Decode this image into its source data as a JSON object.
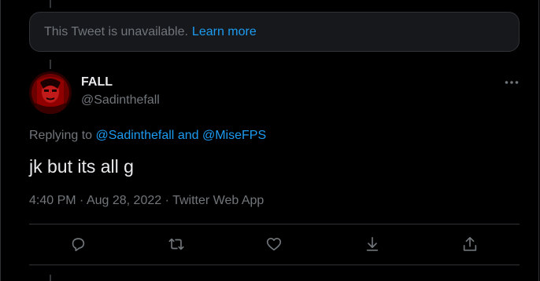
{
  "unavailable": {
    "message": "This Tweet is unavailable.",
    "learn_more": "Learn more"
  },
  "tweet": {
    "author_name": "FALL",
    "author_handle": "@Sadinthefall",
    "replying_prefix": "Replying to",
    "replying_user1": "@Sadinthefall",
    "replying_and": "and",
    "replying_user2": "@MiseFPS",
    "text": "jk but its all g",
    "time": "4:40 PM",
    "date": "Aug 28, 2022",
    "source": "Twitter Web App",
    "separator": "·"
  },
  "icons": {
    "more": "more-horizontal-icon",
    "reply": "reply-icon",
    "retweet": "retweet-icon",
    "like": "heart-icon",
    "bookmark": "bookmark-download-icon",
    "share": "share-icon"
  },
  "colors": {
    "background": "#000000",
    "accent": "#1d9bf0",
    "muted": "#71767b",
    "border": "#2f3336"
  }
}
